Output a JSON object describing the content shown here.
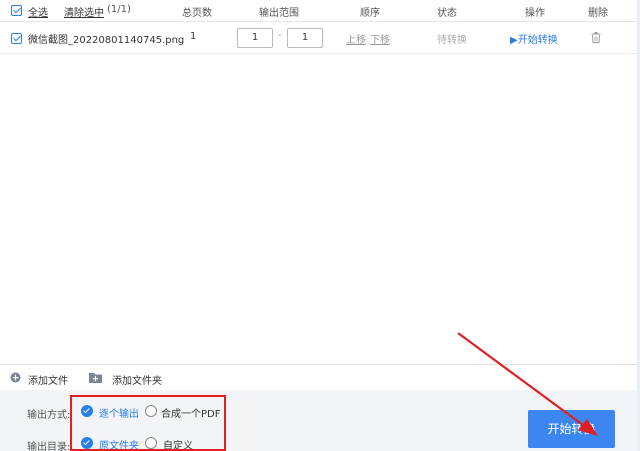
{
  "header": {
    "select_all": "全选",
    "clear_selected": "清除选中",
    "count": "(1/1)",
    "col_total_pages": "总页数",
    "col_output_range": "输出范围",
    "col_order": "顺序",
    "col_status": "状态",
    "col_action": "操作",
    "col_delete": "删除"
  },
  "files": [
    {
      "name": "微信截图_20220801140745.png",
      "total_pages": "1",
      "range_from": "1",
      "range_to": "1",
      "range_sep": "-",
      "move_up": "上移",
      "move_down": "下移",
      "status": "待转换",
      "action": "▶开始转换",
      "checked": true
    }
  ],
  "toolbar": {
    "add_file": "添加文件",
    "add_folder": "添加文件夹"
  },
  "bottom": {
    "output_mode_label": "输出方式:",
    "output_mode_options": [
      "逐个输出",
      "合成一个PDF"
    ],
    "output_mode_selected": "逐个输出",
    "output_dir_label": "输出目录:",
    "output_dir_options": [
      "原文件夹",
      "自定义"
    ],
    "output_dir_selected": "原文件夹",
    "start_button": "开始转换"
  },
  "colors": {
    "accent": "#2b7de9",
    "button": "#3b86f0",
    "highlight": "#e02020"
  }
}
